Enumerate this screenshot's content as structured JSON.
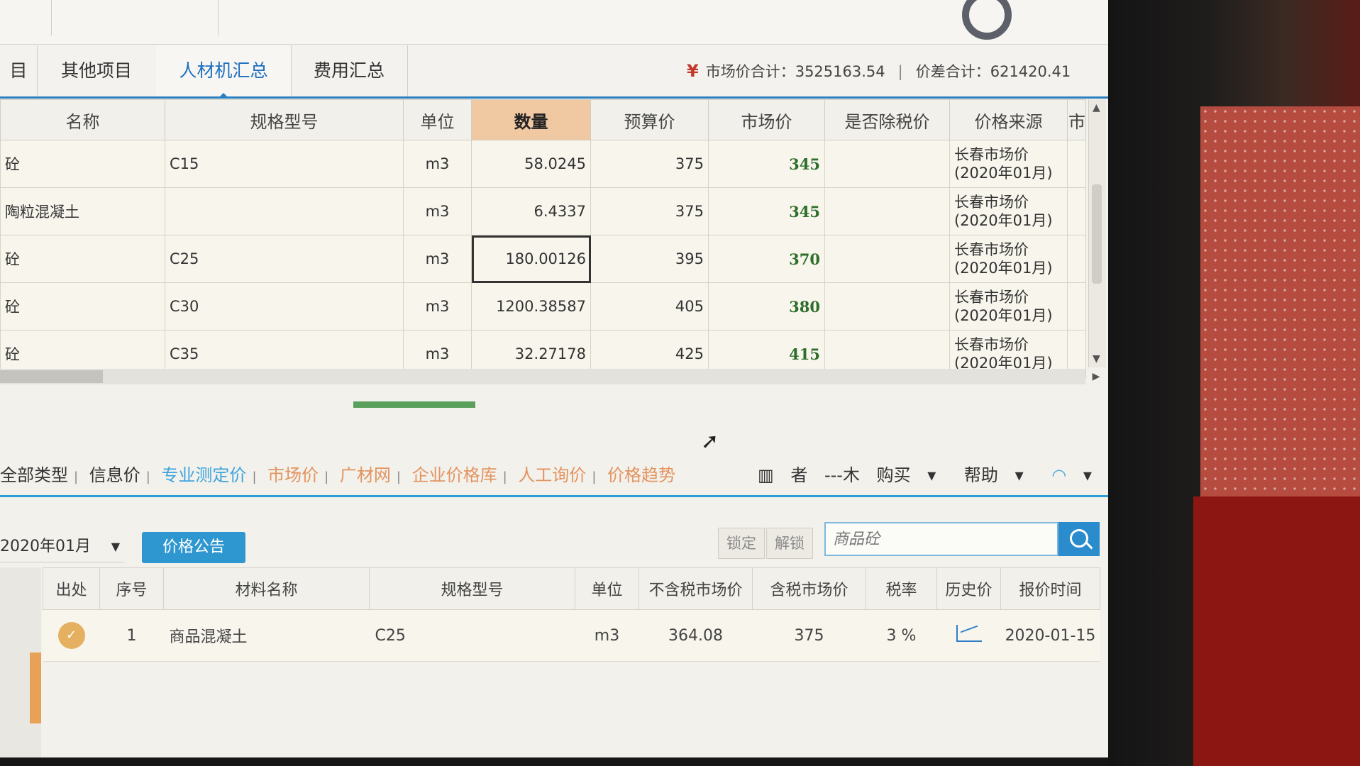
{
  "tabs": [
    {
      "label": "目",
      "active": false
    },
    {
      "label": "其他项目",
      "active": false
    },
    {
      "label": "人材机汇总",
      "active": true
    },
    {
      "label": "费用汇总",
      "active": false
    }
  ],
  "totals": {
    "currency_symbol": "¥",
    "market_total_label": "市场价合计：",
    "market_total_value": "3525163.54",
    "diff_total_label": "价差合计：",
    "diff_total_value": "621420.41"
  },
  "main_grid": {
    "columns": [
      "名称",
      "规格型号",
      "单位",
      "数量",
      "预算价",
      "市场价",
      "是否除税价",
      "价格来源",
      "市"
    ],
    "sorted_column": "数量",
    "rows": [
      {
        "name": "砼",
        "spec": "C15",
        "unit": "m3",
        "qty": "58.0245",
        "budget": "375",
        "market": "345",
        "tax_excl": "",
        "source": "长春市场价(2020年01月)"
      },
      {
        "name": "陶粒混凝土",
        "spec": "",
        "unit": "m3",
        "qty": "6.4337",
        "budget": "375",
        "market": "345",
        "tax_excl": "",
        "source": "长春市场价(2020年01月)"
      },
      {
        "name": "砼",
        "spec": "C25",
        "unit": "m3",
        "qty": "180.00126",
        "budget": "395",
        "market": "370",
        "tax_excl": "",
        "source": "长春市场价(2020年01月)"
      },
      {
        "name": "砼",
        "spec": "C30",
        "unit": "m3",
        "qty": "1200.38587",
        "budget": "405",
        "market": "380",
        "tax_excl": "",
        "source": "长春市场价(2020年01月)"
      },
      {
        "name": "砼",
        "spec": "C35",
        "unit": "m3",
        "qty": "32.27178",
        "budget": "425",
        "market": "415",
        "tax_excl": "",
        "source": "长春市场价(2020年01月)"
      }
    ],
    "selected_cell": {
      "row": 2,
      "column": "数量"
    }
  },
  "price_links": {
    "items": [
      "全部类型",
      "信息价",
      "专业测定价",
      "市场价",
      "广材网",
      "企业价格库",
      "人工询价",
      "价格趋势"
    ],
    "right": [
      "者",
      "---木",
      "购买",
      "帮助"
    ]
  },
  "filter": {
    "date": "2020年01月",
    "notice_button": "价格公告",
    "lock_button": "锁定",
    "unlock_button": "解锁",
    "search_placeholder": "商品砼"
  },
  "price_grid": {
    "columns": [
      "出处",
      "序号",
      "材料名称",
      "规格型号",
      "单位",
      "不含税市场价",
      "含税市场价",
      "税率",
      "历史价",
      "报价时间"
    ],
    "rows": [
      {
        "origin": "✓",
        "index": "1",
        "name": "商品混凝土",
        "spec": "C25",
        "unit": "m3",
        "price_excl_tax": "364.08",
        "price_incl_tax": "375",
        "tax_rate": "3 %",
        "history_icon": "line-chart-icon",
        "quote_date": "2020-01-15"
      }
    ]
  },
  "colors": {
    "accent": "#2a7fc1",
    "sorted_header": "#f0c9a2",
    "market_price": "#2e6e2a",
    "link_orange": "#e39460",
    "button_blue": "#2f97d0"
  }
}
